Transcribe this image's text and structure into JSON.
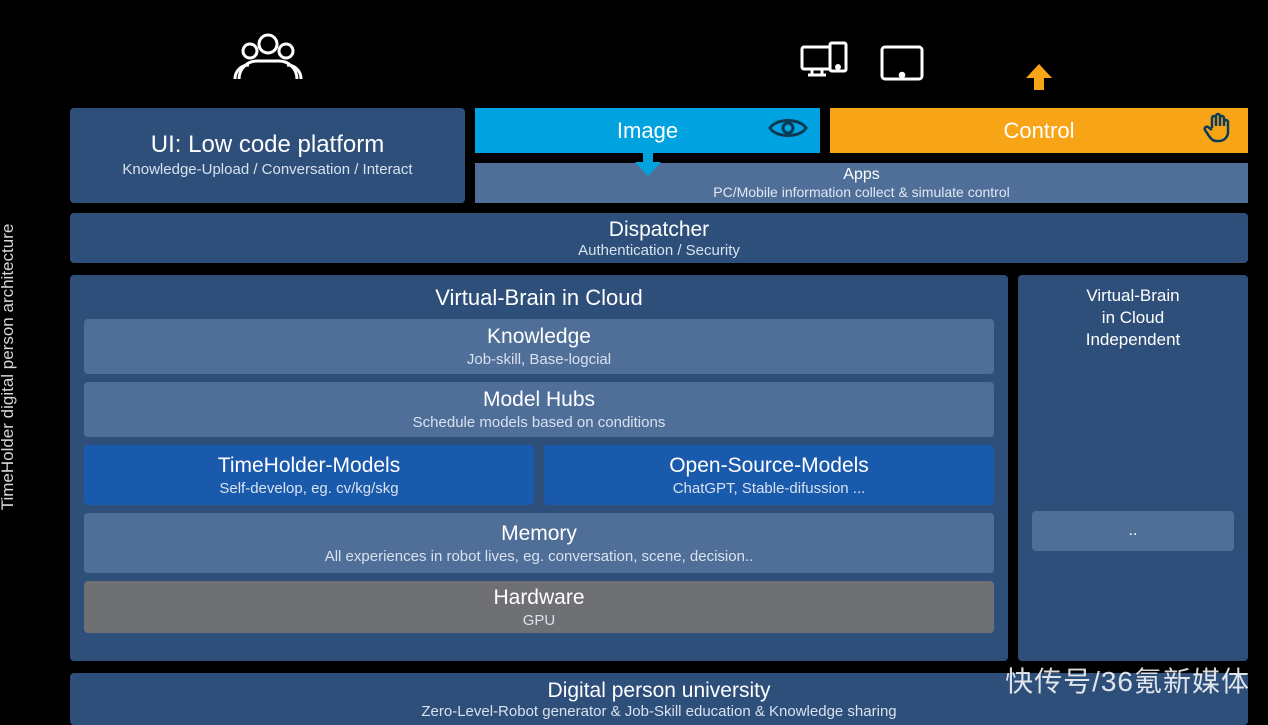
{
  "sidebar_label": "TimeHolder digital person architecture",
  "ui_platform": {
    "title": "UI: Low code platform",
    "subtitle": "Knowledge-Upload / Conversation / Interact"
  },
  "image_box": {
    "label": "Image"
  },
  "control_box": {
    "label": "Control"
  },
  "apps": {
    "title": "Apps",
    "subtitle": "PC/Mobile information collect & simulate control"
  },
  "dispatcher": {
    "title": "Dispatcher",
    "subtitle": "Authentication / Security"
  },
  "vbrain": {
    "title": "Virtual-Brain in Cloud",
    "knowledge": {
      "title": "Knowledge",
      "subtitle": "Job-skill, Base-logcial"
    },
    "model_hubs": {
      "title": "Model Hubs",
      "subtitle": "Schedule models based on conditions"
    },
    "timeholder_models": {
      "title": "TimeHolder-Models",
      "subtitle": "Self-develop, eg. cv/kg/skg"
    },
    "open_source_models": {
      "title": "Open-Source-Models",
      "subtitle": "ChatGPT, Stable-difussion ..."
    },
    "memory": {
      "title": "Memory",
      "subtitle": "All experiences in robot lives, eg. conversation, scene, decision.."
    },
    "hardware": {
      "title": "Hardware",
      "subtitle": "GPU"
    }
  },
  "independent": {
    "line1": "Virtual-Brain",
    "line2": "in Cloud",
    "line3": "Independent",
    "inner": ".."
  },
  "university": {
    "title": "Digital person university",
    "subtitle": "Zero-Level-Robot generator & Job-Skill education & Knowledge sharing"
  },
  "watermark": "快传号/36氪新媒体"
}
